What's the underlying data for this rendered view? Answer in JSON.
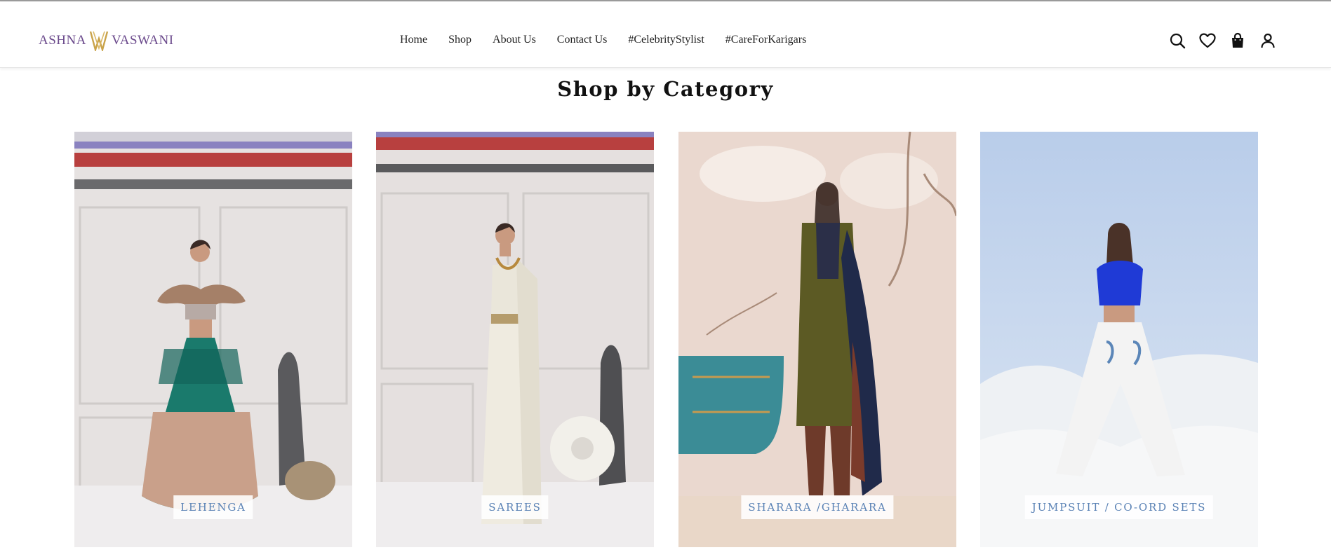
{
  "brand": {
    "left": "ASHNA",
    "right": "VASWANI"
  },
  "nav": [
    {
      "label": "Home"
    },
    {
      "label": "Shop"
    },
    {
      "label": "About Us"
    },
    {
      "label": "Contact Us"
    },
    {
      "label": "#CelebrityStylist"
    },
    {
      "label": "#CareForKarigars"
    }
  ],
  "icons": [
    "search-icon",
    "heart-icon",
    "shopping-bag-icon",
    "user-icon"
  ],
  "colors": {
    "accent": "#6b4a8c",
    "gold": "#c9a34a",
    "label": "#5a82b5"
  },
  "section": {
    "title": "Shop by Category"
  },
  "categories": [
    {
      "label": "LEHENGA"
    },
    {
      "label": "SAREES"
    },
    {
      "label": "SHARARA /GHARARA"
    },
    {
      "label": "JUMPSUIT / CO-ORD SETS"
    }
  ]
}
